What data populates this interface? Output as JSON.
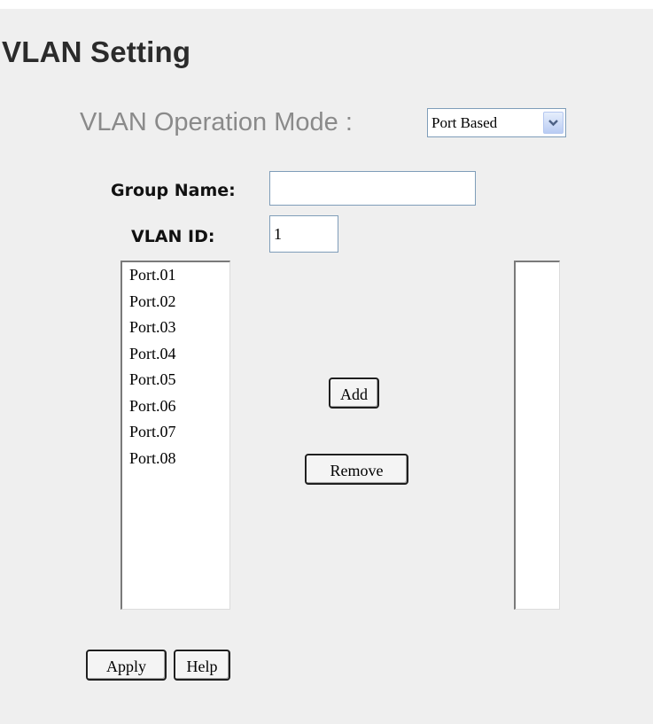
{
  "title": "VLAN Setting",
  "mode": {
    "label": "VLAN Operation Mode :",
    "selected": "Port Based"
  },
  "group_name": {
    "label": "Group Name:",
    "value": ""
  },
  "vlan_id": {
    "label": "VLAN ID:",
    "value": "1"
  },
  "available_ports": [
    "Port.01",
    "Port.02",
    "Port.03",
    "Port.04",
    "Port.05",
    "Port.06",
    "Port.07",
    "Port.08"
  ],
  "member_ports": [],
  "buttons": {
    "add": "Add",
    "remove": "Remove",
    "apply": "Apply",
    "help": "Help"
  },
  "icons": {
    "dropdown": "chevron-down-icon"
  },
  "colors": {
    "panel_bg": "#efefef",
    "input_border": "#7f9db9",
    "dropdown_arrow": "#4d6185"
  }
}
